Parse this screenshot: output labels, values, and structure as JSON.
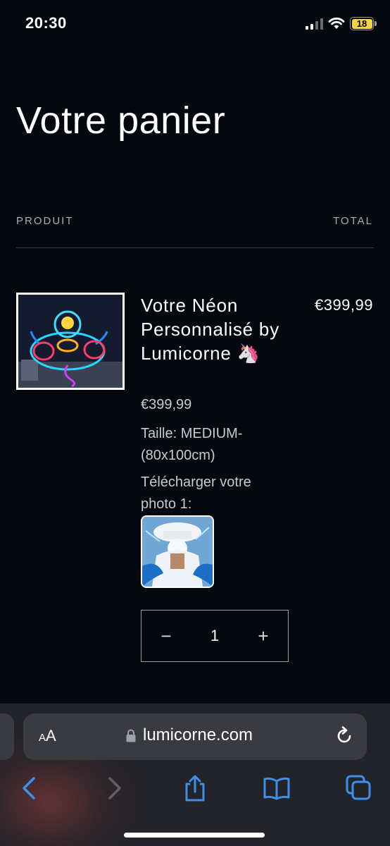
{
  "status_bar": {
    "time": "20:30",
    "battery": "18"
  },
  "cart": {
    "title": "Votre panier",
    "col_product": "PRODUIT",
    "col_total": "TOTAL"
  },
  "item": {
    "name": "Votre Néon Personnalisé by Lumicorne 🦄",
    "price": "€399,99",
    "total": "€399,99",
    "size": "Taille: MEDIUM-(80x100cm)",
    "upload_label": "Télécharger votre photo 1:",
    "quantity": "1",
    "qty_minus": "−",
    "qty_plus": "+"
  },
  "browser": {
    "aa_big": "A",
    "aa_small": "A",
    "url": "lumicorne.com"
  },
  "colors": {
    "background": "#05080f",
    "battery": "#f2d34a",
    "link_blue": "#3d8fe8"
  }
}
